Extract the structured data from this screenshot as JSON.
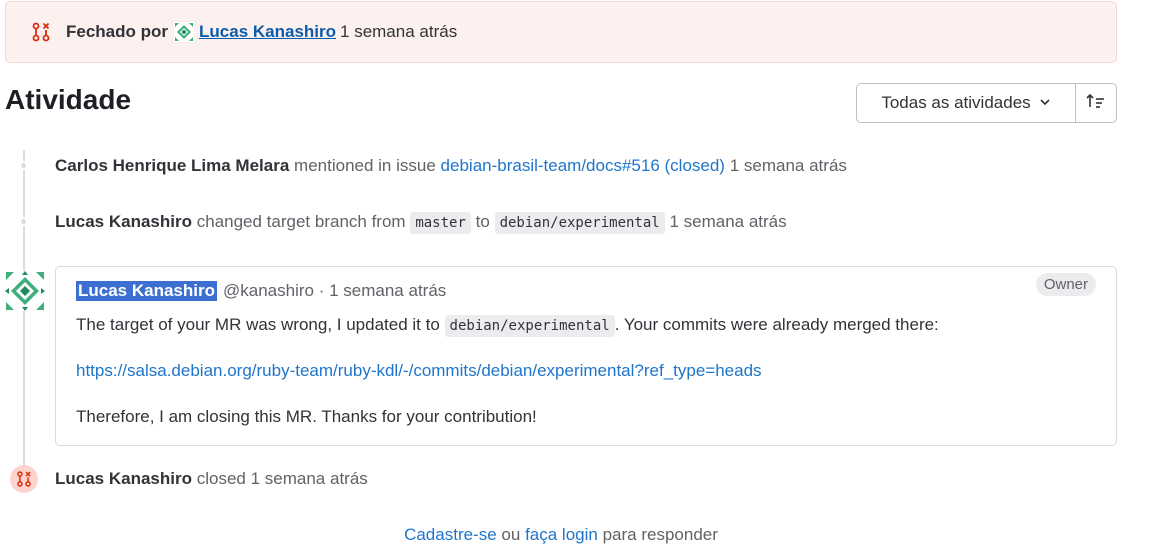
{
  "banner": {
    "label": "Fechado por",
    "user": "Lucas Kanashiro",
    "time": "1 semana atrás"
  },
  "activity": {
    "title": "Atividade",
    "filter_label": "Todas as atividades"
  },
  "events": [
    {
      "who": "Carlos Henrique Lima Melara",
      "action": "mentioned in issue",
      "link": "debian-brasil-team/docs#516 (closed)",
      "time": "1 semana atrás"
    },
    {
      "who": "Lucas Kanashiro",
      "action": "changed target branch from",
      "from": "master",
      "to_word": "to",
      "to": "debian/experimental",
      "time": "1 semana atrás"
    }
  ],
  "note": {
    "author": "Lucas Kanashiro",
    "handle": "@kanashiro",
    "sep": "·",
    "time": "1 semana atrás",
    "role": "Owner",
    "line1_pre": "The target of your MR was wrong, I updated it to",
    "line1_code": "debian/experimental",
    "line1_post": ". Your commits were already merged there:",
    "link": "https://salsa.debian.org/ruby-team/ruby-kdl/-/commits/debian/experimental?ref_type=heads",
    "line3": "Therefore, I am closing this MR. Thanks for your contribution!"
  },
  "closed_event": {
    "who": "Lucas Kanashiro",
    "action": "closed",
    "time": "1 semana atrás"
  },
  "footer": {
    "register": "Cadastre-se",
    "or": "ou",
    "login": "faça login",
    "suffix": "para responder"
  },
  "colors": {
    "accent_link": "#1f75cb",
    "closed_red": "#dd2b0e",
    "banner_bg": "#fcf1ef"
  }
}
